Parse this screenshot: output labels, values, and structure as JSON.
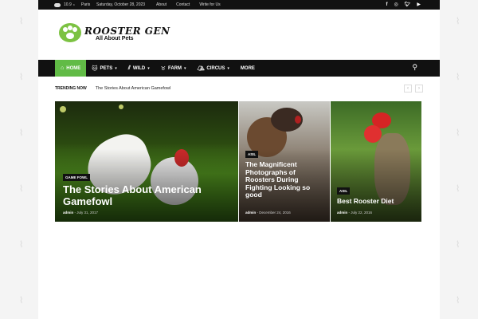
{
  "topbar": {
    "weather_temp": "10.9",
    "weather_unit": "C",
    "weather_city": "Paris",
    "date": "Saturday, October 28, 2023",
    "links": [
      "About",
      "Contact",
      "Write for Us"
    ],
    "social": [
      "facebook-icon",
      "instagram-icon",
      "twitter-icon",
      "youtube-icon"
    ]
  },
  "logo": {
    "title": "ROOSTER GEN",
    "subtitle": "All About Pets"
  },
  "nav": {
    "items": [
      {
        "label": "HOME",
        "icon": "home-icon",
        "dropdown": false,
        "active": true
      },
      {
        "label": "PETS",
        "icon": "cat-icon",
        "dropdown": true
      },
      {
        "label": "WILD",
        "icon": "claw-icon",
        "dropdown": true
      },
      {
        "label": "FARM",
        "icon": "cow-icon",
        "dropdown": true
      },
      {
        "label": "CIRCUS",
        "icon": "tent-icon",
        "dropdown": true
      },
      {
        "label": "MORE",
        "icon": "",
        "dropdown": false
      }
    ],
    "accent": "#61bb46"
  },
  "trending": {
    "label": "TRENDING NOW",
    "headline": "The Stories About American Gamefowl"
  },
  "featured": [
    {
      "category": "GAME FOWL",
      "title": "The Stories About American Gamefowl",
      "author": "admin",
      "date": "July 31, 2017"
    },
    {
      "category": "ASIL",
      "title": "The Magnificent Photographs of Roosters During Fighting Looking so good",
      "author": "admin",
      "date": "December 24, 2016"
    },
    {
      "category": "ASIL",
      "title": "Best Rooster Diet",
      "author": "admin",
      "date": "July 22, 2016"
    }
  ]
}
